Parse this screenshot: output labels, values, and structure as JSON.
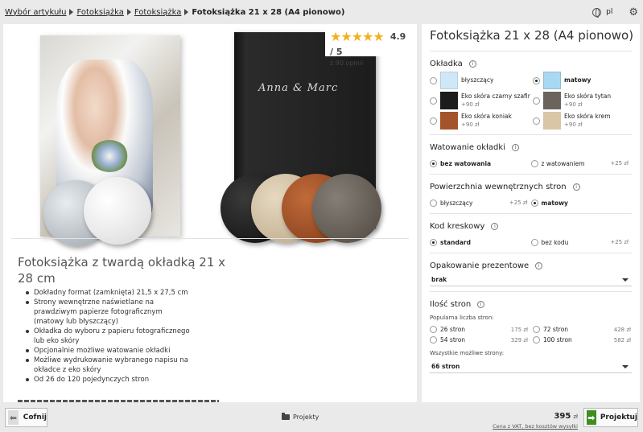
{
  "breadcrumb": {
    "items": [
      "Wybór artykułu",
      "Fotoksiążka",
      "Fotoksiążka"
    ],
    "current": "Fotoksiążka 21 x 28 (A4 pionowo)"
  },
  "topbar": {
    "language": "pl"
  },
  "rating": {
    "stars": "★★★★★",
    "score": "4.9 / 5",
    "reviews": "z 90 opinii"
  },
  "cover_text": "Anna & Marc",
  "product": {
    "title": "Fotoksiążka z twardą okładką 21 x 28 cm",
    "features": [
      "Dokładny format (zamknięta) 21,5 x 27,5 cm",
      "Strony wewnętrzne naświetlane na prawdziwym papierze fotograficznym (matowy lub błyszczący)",
      "Okładka do wyboru z papieru fotograficznego lub eko skóry",
      "Opcjonalnie możliwe watowanie okładki",
      "Możliwe wydrukowanie wybranego napisu na okładce z eko skóry",
      "Od 26 do 120 pojedynczych stron"
    ]
  },
  "config": {
    "title": "Fotoksiążka 21 x 28 (A4 pionowo)",
    "cover": {
      "label": "Okładka",
      "options": [
        {
          "label": "błyszczący",
          "price": "",
          "color": "#cfe8f7",
          "selected": false
        },
        {
          "label": "matowy",
          "price": "",
          "color": "#a9d8f3",
          "selected": true
        },
        {
          "label": "Eko skóra czarny szafir",
          "price": "+90 zł",
          "color": "#1c1c1c",
          "selected": false
        },
        {
          "label": "Eko skóra tytan",
          "price": "+90 zł",
          "color": "#6b645d",
          "selected": false
        },
        {
          "label": "Eko skóra koniak",
          "price": "+90 zł",
          "color": "#a4542a",
          "selected": false
        },
        {
          "label": "Eko skóra krem",
          "price": "+90 zł",
          "color": "#d8c6a6",
          "selected": false
        }
      ]
    },
    "padding": {
      "label": "Watowanie okładki",
      "opt1": "bez watowania",
      "opt2": "z watowaniem",
      "opt2_price": "+25 zł"
    },
    "surface": {
      "label": "Powierzchnia wewnętrznych stron",
      "opt1": "błyszczący",
      "opt1_price": "+25 zł",
      "opt2": "matowy"
    },
    "barcode": {
      "label": "Kod kreskowy",
      "opt1": "standard",
      "opt2": "bez kodu",
      "opt2_price": "+25 zł"
    },
    "gift": {
      "label": "Opakowanie prezentowe",
      "value": "brak"
    },
    "pages": {
      "label": "Ilość stron",
      "popular_label": "Popularna liczba stron:",
      "options": [
        {
          "label": "26 stron",
          "price": "175 zł"
        },
        {
          "label": "72 stron",
          "price": "428 zł"
        },
        {
          "label": "54 stron",
          "price": "329 zł"
        },
        {
          "label": "100 stron",
          "price": "582 zł"
        }
      ],
      "all_label": "Wszystkie możliwe strony:",
      "all_value": "66 stron"
    }
  },
  "footer": {
    "back": "Cofnij",
    "projects": "Projekty",
    "price": "395",
    "currency": "zł",
    "vat": "Cena z VAT, bez kosztów wysyłki",
    "project_btn": "Projektuj"
  }
}
